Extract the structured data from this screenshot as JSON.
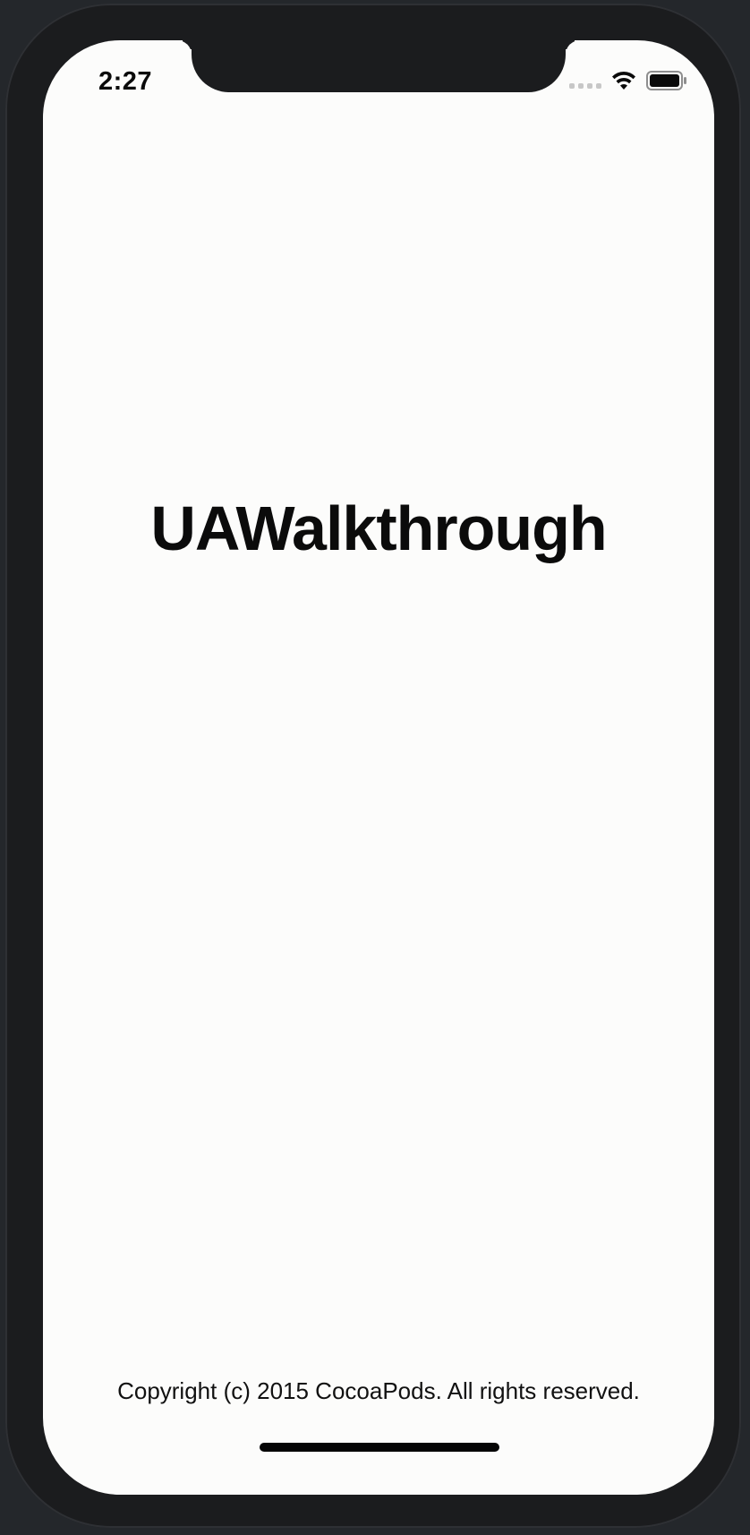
{
  "status_bar": {
    "time": "2:27",
    "icons": [
      "cellular-signal-icon",
      "wifi-icon",
      "battery-icon"
    ]
  },
  "main": {
    "title": "UAWalkthrough"
  },
  "footer": {
    "copyright": "Copyright (c) 2015 CocoaPods. All rights reserved."
  },
  "colors": {
    "background": "#fcfcfb",
    "text": "#0b0b0b",
    "bezel": "#1b1c1e"
  }
}
